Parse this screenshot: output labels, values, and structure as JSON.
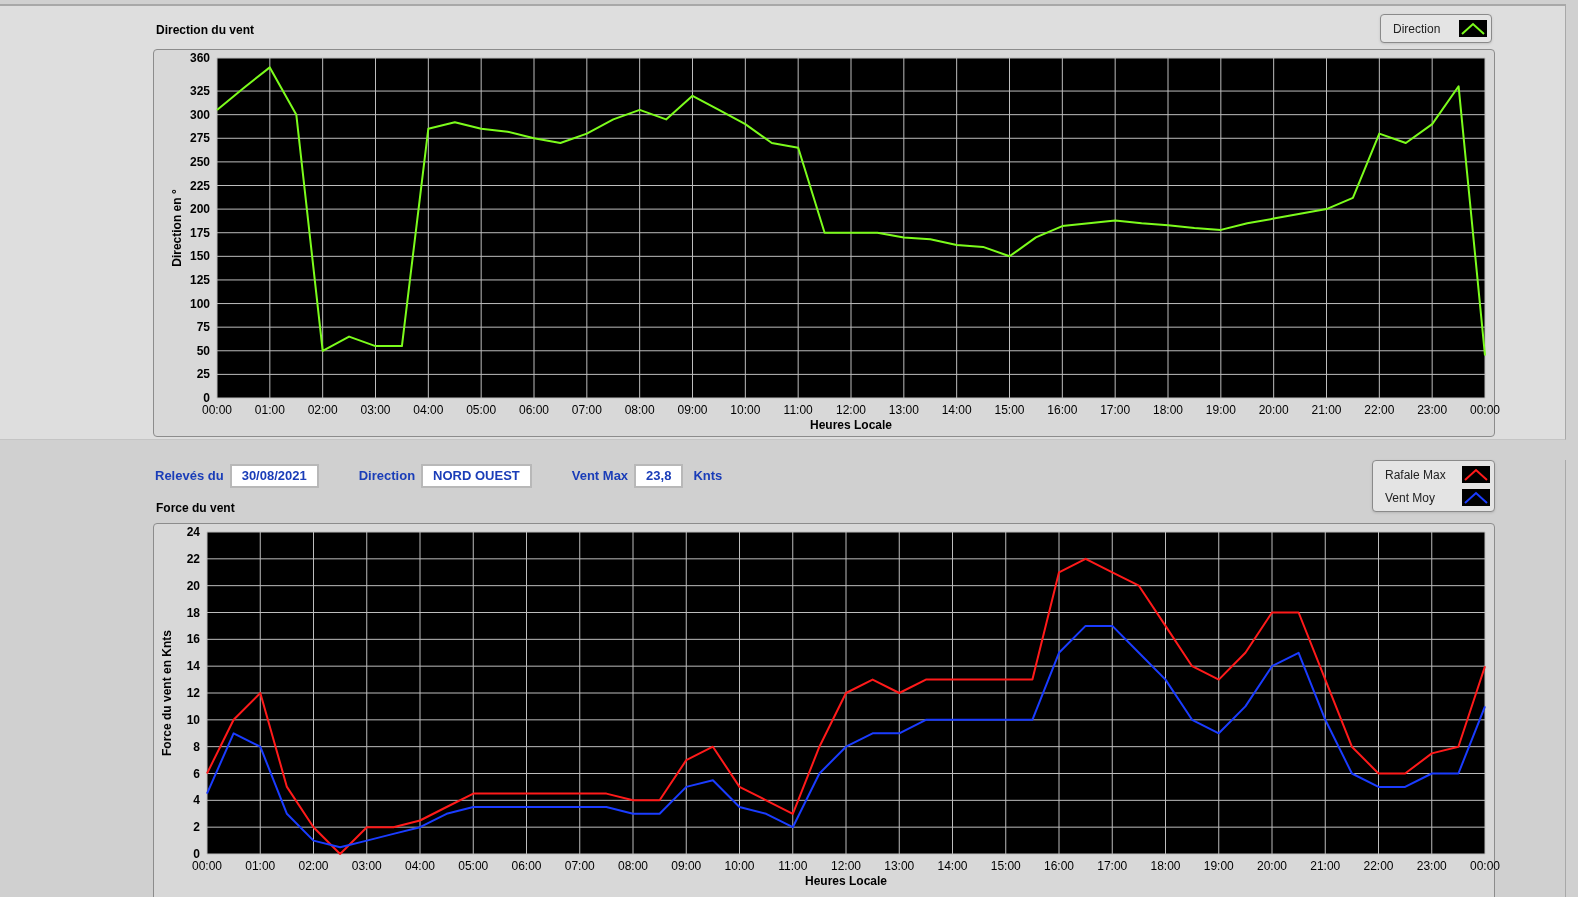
{
  "direction_chart": {
    "title": "Direction du vent",
    "chart_data": {
      "type": "line",
      "grid": true,
      "xlabel": "Heures Locale",
      "ylabel": "Direction en °",
      "x": [
        0,
        0.5,
        1,
        1.5,
        2,
        2.5,
        3,
        3.5,
        4,
        4.5,
        5,
        5.5,
        6,
        6.5,
        7,
        7.5,
        8,
        8.5,
        9,
        9.5,
        10,
        10.5,
        11,
        11.5,
        12,
        12.5,
        13,
        13.5,
        14,
        14.5,
        15,
        15.5,
        16,
        16.5,
        17,
        17.5,
        18,
        18.5,
        19,
        19.5,
        20,
        20.5,
        21,
        21.5,
        22,
        22.5,
        23,
        23.5,
        24
      ],
      "series": [
        {
          "name": "Direction",
          "color": "#7cfc1c",
          "values": [
            305,
            328,
            350,
            300,
            50,
            65,
            55,
            55,
            285,
            292,
            285,
            282,
            275,
            270,
            280,
            295,
            305,
            295,
            320,
            305,
            290,
            270,
            265,
            175,
            175,
            175,
            170,
            168,
            162,
            160,
            150,
            170,
            182,
            185,
            188,
            185,
            183,
            180,
            178,
            185,
            190,
            195,
            200,
            212,
            280,
            270,
            290,
            330,
            45
          ]
        }
      ],
      "xlim": [
        0,
        24
      ],
      "ylim": [
        0,
        360
      ],
      "xticks": [
        {
          "value": 0,
          "label": "00:00"
        },
        {
          "value": 1,
          "label": "01:00"
        },
        {
          "value": 2,
          "label": "02:00"
        },
        {
          "value": 3,
          "label": "03:00"
        },
        {
          "value": 4,
          "label": "04:00"
        },
        {
          "value": 5,
          "label": "05:00"
        },
        {
          "value": 6,
          "label": "06:00"
        },
        {
          "value": 7,
          "label": "07:00"
        },
        {
          "value": 8,
          "label": "08:00"
        },
        {
          "value": 9,
          "label": "09:00"
        },
        {
          "value": 10,
          "label": "10:00"
        },
        {
          "value": 11,
          "label": "11:00"
        },
        {
          "value": 12,
          "label": "12:00"
        },
        {
          "value": 13,
          "label": "13:00"
        },
        {
          "value": 14,
          "label": "14:00"
        },
        {
          "value": 15,
          "label": "15:00"
        },
        {
          "value": 16,
          "label": "16:00"
        },
        {
          "value": 17,
          "label": "17:00"
        },
        {
          "value": 18,
          "label": "18:00"
        },
        {
          "value": 19,
          "label": "19:00"
        },
        {
          "value": 20,
          "label": "20:00"
        },
        {
          "value": 21,
          "label": "21:00"
        },
        {
          "value": 22,
          "label": "22:00"
        },
        {
          "value": 23,
          "label": "23:00"
        },
        {
          "value": 24,
          "label": "00:00"
        }
      ],
      "yticks": [
        0,
        25,
        50,
        75,
        100,
        125,
        150,
        175,
        200,
        225,
        250,
        275,
        300,
        325,
        360
      ]
    }
  },
  "readings": [
    {
      "label": "Relevés du",
      "value": "30/08/2021"
    },
    {
      "label": "Direction",
      "value": "NORD OUEST"
    },
    {
      "label": "Vent Max",
      "value": "23,8",
      "unit": "Knts"
    }
  ],
  "force_chart": {
    "title": "Force du vent",
    "chart_data": {
      "type": "line",
      "grid": true,
      "xlabel": "Heures Locale",
      "ylabel": "Force du vent en Knts",
      "x": [
        0,
        0.5,
        1,
        1.5,
        2,
        2.5,
        3,
        3.5,
        4,
        4.5,
        5,
        5.5,
        6,
        6.5,
        7,
        7.5,
        8,
        8.5,
        9,
        9.5,
        10,
        10.5,
        11,
        11.5,
        12,
        12.5,
        13,
        13.5,
        14,
        14.5,
        15,
        15.5,
        16,
        16.5,
        17,
        17.5,
        18,
        18.5,
        19,
        19.5,
        20,
        20.5,
        21,
        21.5,
        22,
        22.5,
        23,
        23.5,
        24
      ],
      "series": [
        {
          "name": "Rafale Max",
          "color": "#ff1a1a",
          "values": [
            6,
            10,
            12,
            5,
            2,
            0,
            2,
            2,
            2.5,
            3.5,
            4.5,
            4.5,
            4.5,
            4.5,
            4.5,
            4.5,
            4,
            4,
            7,
            8,
            5,
            4,
            3,
            8,
            12,
            13,
            12,
            13,
            13,
            13,
            13,
            13,
            21,
            22,
            21,
            20,
            17,
            14,
            13,
            15,
            18,
            18,
            13,
            8,
            6,
            6,
            7.5,
            8,
            14
          ]
        },
        {
          "name": "Vent Moy",
          "color": "#1a3cff",
          "values": [
            4.5,
            9,
            8,
            3,
            1,
            0.5,
            1,
            1.5,
            2,
            3,
            3.5,
            3.5,
            3.5,
            3.5,
            3.5,
            3.5,
            3,
            3,
            5,
            5.5,
            3.5,
            3,
            2,
            6,
            8,
            9,
            9,
            10,
            10,
            10,
            10,
            10,
            15,
            17,
            17,
            15,
            13,
            10,
            9,
            11,
            14,
            15,
            10,
            6,
            5,
            5,
            6,
            6,
            11
          ]
        }
      ],
      "xlim": [
        0,
        24
      ],
      "ylim": [
        0,
        24
      ],
      "xticks": [
        {
          "value": 0,
          "label": "00:00"
        },
        {
          "value": 1,
          "label": "01:00"
        },
        {
          "value": 2,
          "label": "02:00"
        },
        {
          "value": 3,
          "label": "03:00"
        },
        {
          "value": 4,
          "label": "04:00"
        },
        {
          "value": 5,
          "label": "05:00"
        },
        {
          "value": 6,
          "label": "06:00"
        },
        {
          "value": 7,
          "label": "07:00"
        },
        {
          "value": 8,
          "label": "08:00"
        },
        {
          "value": 9,
          "label": "09:00"
        },
        {
          "value": 10,
          "label": "10:00"
        },
        {
          "value": 11,
          "label": "11:00"
        },
        {
          "value": 12,
          "label": "12:00"
        },
        {
          "value": 13,
          "label": "13:00"
        },
        {
          "value": 14,
          "label": "14:00"
        },
        {
          "value": 15,
          "label": "15:00"
        },
        {
          "value": 16,
          "label": "16:00"
        },
        {
          "value": 17,
          "label": "17:00"
        },
        {
          "value": 18,
          "label": "18:00"
        },
        {
          "value": 19,
          "label": "19:00"
        },
        {
          "value": 20,
          "label": "20:00"
        },
        {
          "value": 21,
          "label": "21:00"
        },
        {
          "value": 22,
          "label": "22:00"
        },
        {
          "value": 23,
          "label": "23:00"
        },
        {
          "value": 24,
          "label": "00:00"
        }
      ],
      "yticks": [
        0,
        2,
        4,
        6,
        8,
        10,
        12,
        14,
        16,
        18,
        20,
        22,
        24
      ]
    }
  }
}
